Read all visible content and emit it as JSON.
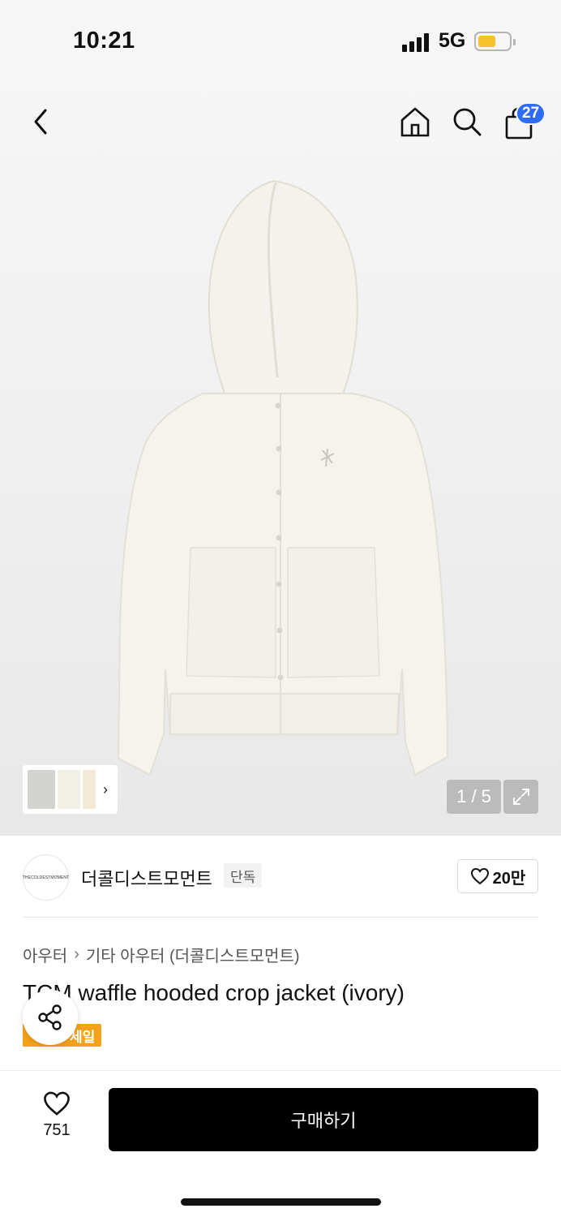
{
  "status_bar": {
    "time": "10:21",
    "network": "5G"
  },
  "header": {
    "cart_count": "27"
  },
  "gallery": {
    "page_indicator": "1 / 5",
    "thumb_arrow": "›"
  },
  "brand": {
    "name": "더콜디스트모먼트",
    "exclusive_tag": "단독",
    "logo_text": "THECOLDESTMOMENT",
    "likes": "20만"
  },
  "breadcrumb": {
    "category": "아우터",
    "separator": "›",
    "subcategory": "기타 아우터 (더콜디스트모먼트)"
  },
  "product": {
    "title": "TCM waffle hooded crop jacket (ivory)",
    "sale_badge": "세일"
  },
  "bottom_bar": {
    "wish_count": "751",
    "buy_label": "구매하기"
  },
  "colors": {
    "accent_blue": "#2f6cf6",
    "sale_orange": "#f5a21b",
    "buy_black": "#000000"
  },
  "icons": [
    "back-icon",
    "home-icon",
    "search-icon",
    "cart-icon",
    "expand-icon",
    "heart-icon",
    "share-icon"
  ]
}
